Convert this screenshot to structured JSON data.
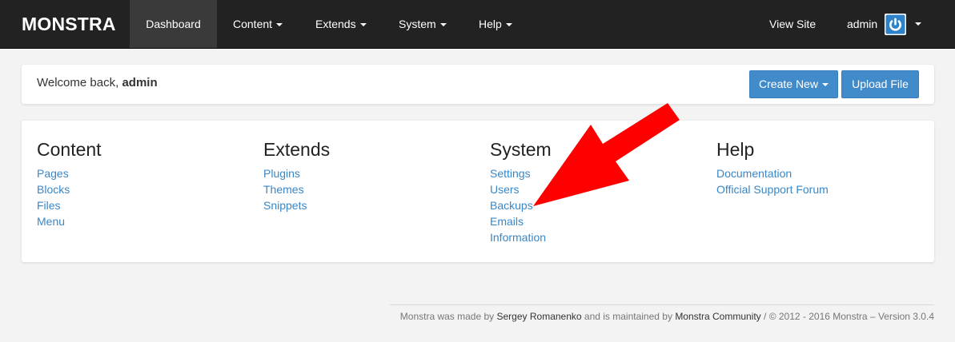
{
  "navbar": {
    "brand": "MONSTRA",
    "items": [
      {
        "label": "Dashboard"
      },
      {
        "label": "Content"
      },
      {
        "label": "Extends"
      },
      {
        "label": "System"
      },
      {
        "label": "Help"
      }
    ],
    "view_site": "View Site",
    "user": "admin",
    "user_icon": "power-icon",
    "active_bg": "#3a3a3a"
  },
  "welcome": {
    "prefix": "Welcome back, ",
    "username": "admin",
    "create_new": "Create New",
    "upload_file": "Upload File"
  },
  "sections": {
    "content": {
      "title": "Content",
      "links": [
        "Pages",
        "Blocks",
        "Files",
        "Menu"
      ]
    },
    "extends": {
      "title": "Extends",
      "links": [
        "Plugins",
        "Themes",
        "Snippets"
      ]
    },
    "system": {
      "title": "System",
      "links": [
        "Settings",
        "Users",
        "Backups",
        "Emails",
        "Information"
      ]
    },
    "help": {
      "title": "Help",
      "links": [
        "Documentation",
        "Official Support Forum"
      ]
    }
  },
  "annotation": {
    "type": "red-arrow",
    "color": "#ff0000",
    "points_to": "Backups"
  },
  "footer": {
    "text1": "Monstra was made by ",
    "author": "Sergey Romanenko",
    "text2": " and is maintained by ",
    "community": "Monstra Community",
    "text3": " / © 2012 - 2016 Monstra – Version 3.0.4"
  },
  "colors": {
    "navbar": "#222222",
    "primary": "#428bca",
    "link": "#3887c8",
    "background": "#f3f3f3"
  }
}
